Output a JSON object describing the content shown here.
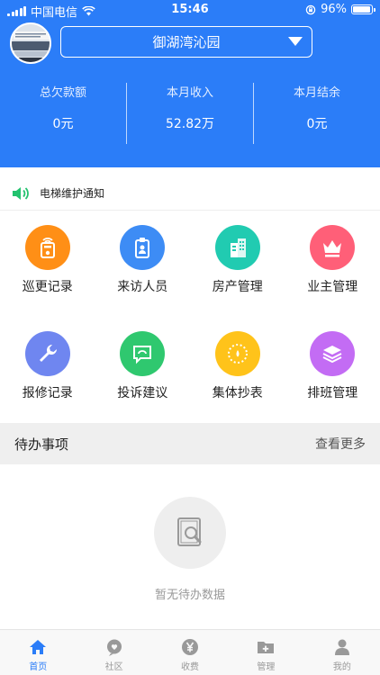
{
  "status_bar": {
    "carrier": "中国电信",
    "time": "15:46",
    "battery": "96%"
  },
  "community": {
    "name": "御湖湾沁园"
  },
  "stats": [
    {
      "label": "总欠款额",
      "value": "0元"
    },
    {
      "label": "本月收入",
      "value": "52.82万"
    },
    {
      "label": "本月结余",
      "value": "0元"
    }
  ],
  "notice": {
    "text": "电梯维护通知"
  },
  "grid": [
    {
      "label": "巡更记录",
      "icon": "patrol-icon",
      "color": "#ff8f16"
    },
    {
      "label": "来访人员",
      "icon": "visitor-badge-icon",
      "color": "#3d8cf5"
    },
    {
      "label": "房产管理",
      "icon": "building-icon",
      "color": "#21cbb1"
    },
    {
      "label": "业主管理",
      "icon": "crown-icon",
      "color": "#ff5f78"
    },
    {
      "label": "报修记录",
      "icon": "wrench-icon",
      "color": "#6f86f0"
    },
    {
      "label": "投诉建议",
      "icon": "chat-icon",
      "color": "#2fc86f"
    },
    {
      "label": "集体抄表",
      "icon": "meter-icon",
      "color": "#ffc31a"
    },
    {
      "label": "排班管理",
      "icon": "layers-icon",
      "color": "#c36cf4"
    }
  ],
  "todo": {
    "title": "待办事项",
    "more": "查看更多",
    "empty_text": "暂无待办数据"
  },
  "tabs": [
    {
      "label": "首页",
      "icon": "home-icon",
      "active": true
    },
    {
      "label": "社区",
      "icon": "chat-bubble-icon",
      "active": false
    },
    {
      "label": "收费",
      "icon": "yen-icon",
      "active": false
    },
    {
      "label": "管理",
      "icon": "folder-plus-icon",
      "active": false
    },
    {
      "label": "我的",
      "icon": "user-icon",
      "active": false
    }
  ],
  "colors": {
    "primary": "#2b7df8",
    "notice_icon": "#22c26e"
  }
}
